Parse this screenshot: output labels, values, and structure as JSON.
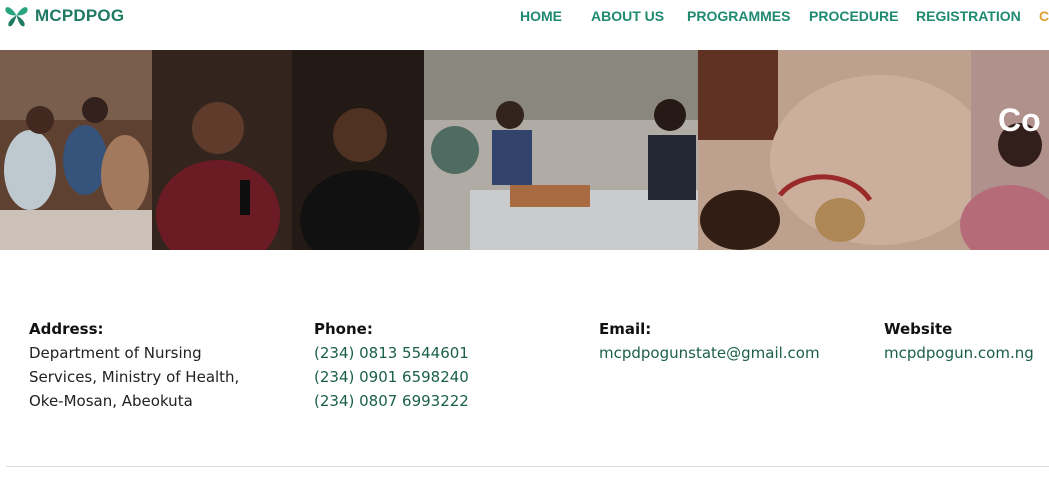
{
  "brand": {
    "name": "MCPDPOG",
    "color": "#1f7a63"
  },
  "nav": {
    "items": [
      {
        "label": "HOME"
      },
      {
        "label": "ABOUT US"
      },
      {
        "label": "PROGRAMMES"
      },
      {
        "label": "PROCEDURE"
      },
      {
        "label": "REGISTRATION"
      },
      {
        "label": "CO"
      }
    ],
    "color": "#1e8a6e",
    "active_color": "#e0a030"
  },
  "banner": {
    "title": "Co"
  },
  "contact": {
    "address": {
      "heading": "Address:",
      "lines": [
        "Department of Nursing",
        "Services, Ministry of Health,",
        "Oke-Mosan, Abeokuta"
      ]
    },
    "phone": {
      "heading": "Phone:",
      "numbers": [
        "(234) 0813 5544601",
        "(234) 0901 6598240",
        "(234) 0807 6993222"
      ]
    },
    "email": {
      "heading": "Email:",
      "value": "mcpdpogunstate@gmail.com"
    },
    "website": {
      "heading": "Website",
      "value": "mcpdpogun.com.ng"
    },
    "link_color": "#1a5f49"
  }
}
